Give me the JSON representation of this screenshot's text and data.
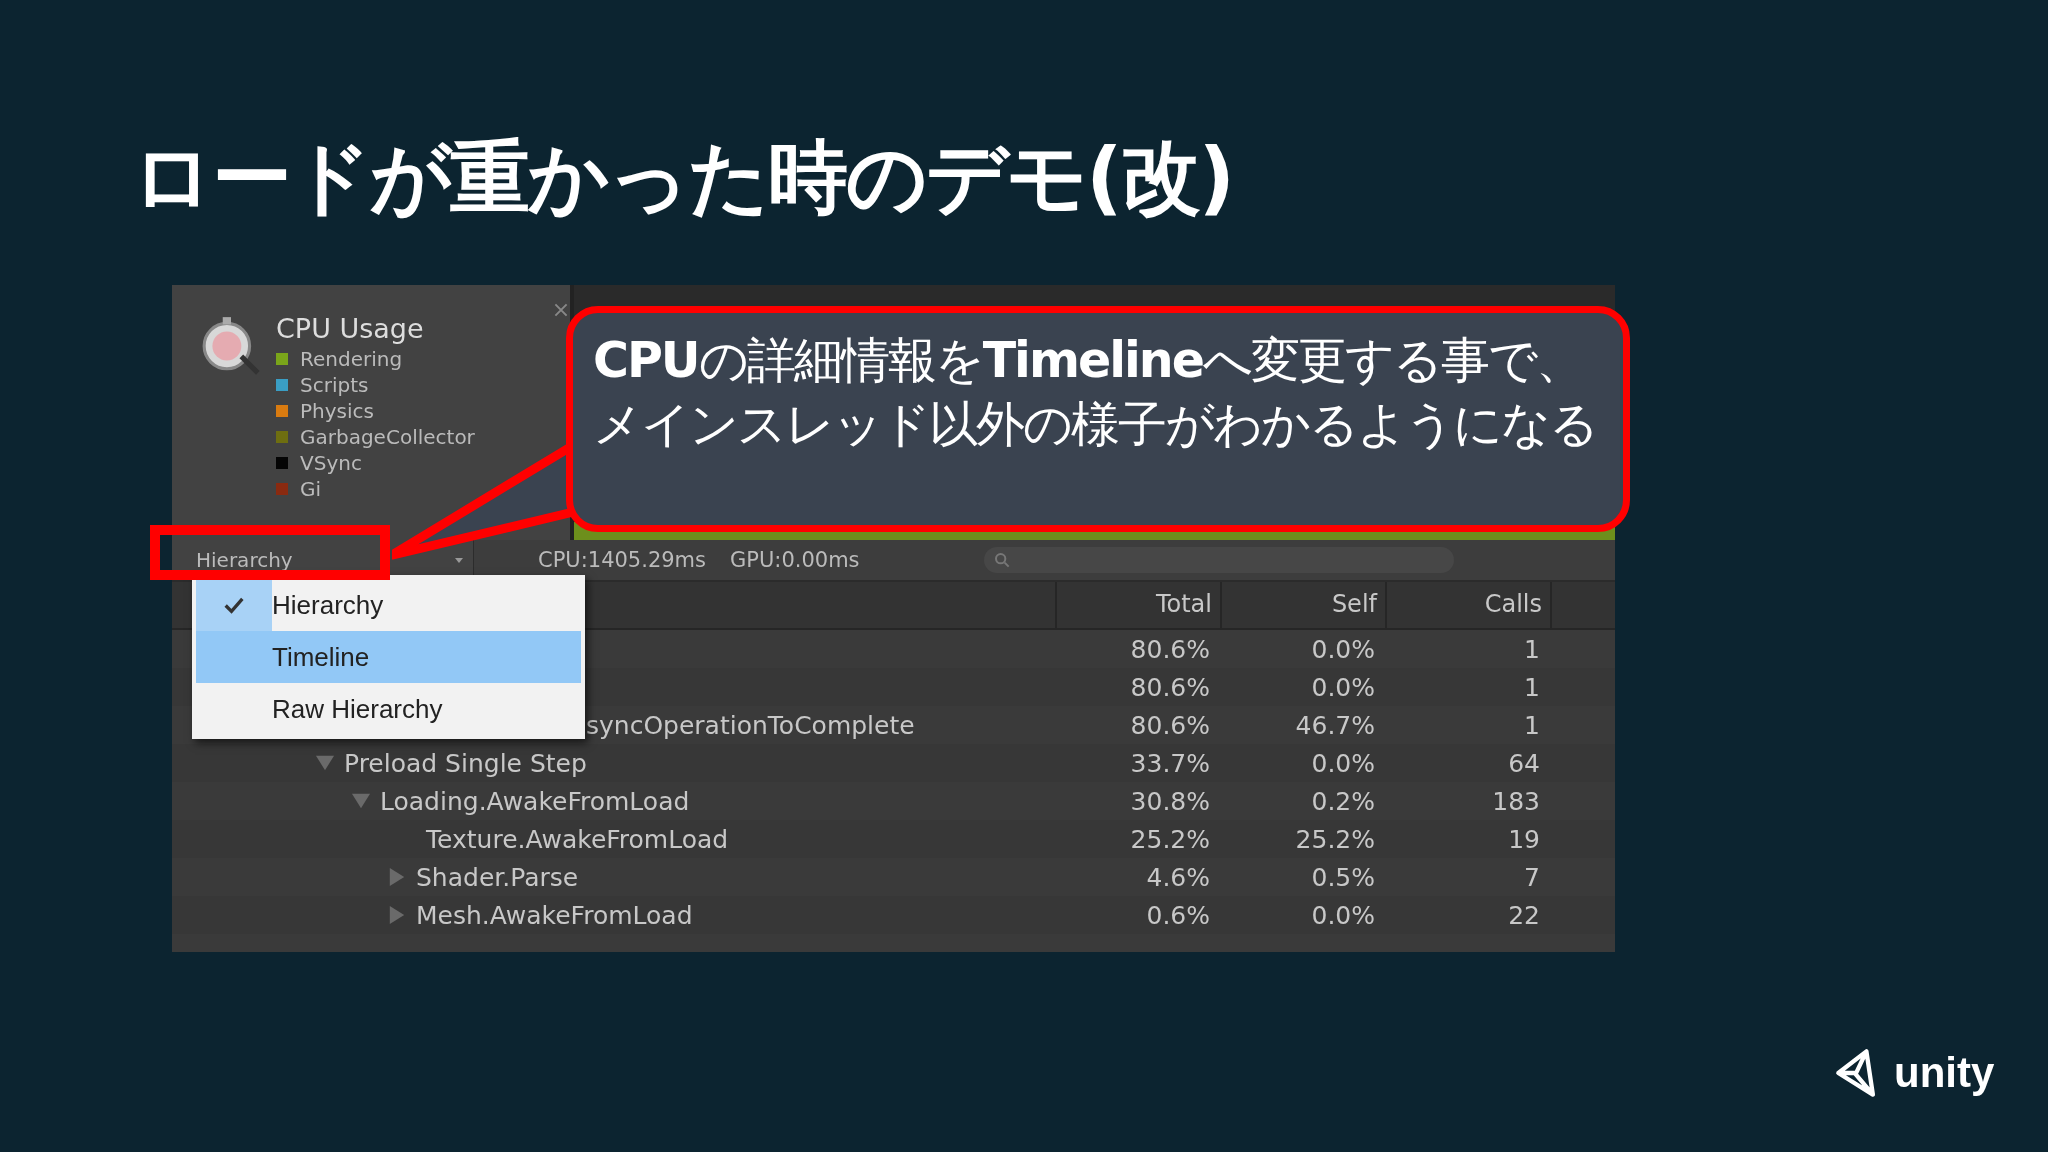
{
  "slide": {
    "title": "ロードが重かった時のデモ(改)"
  },
  "profiler": {
    "module": {
      "title": "CPU Usage",
      "legend": [
        {
          "label": "Rendering",
          "color": "#7aa51a"
        },
        {
          "label": "Scripts",
          "color": "#3a9ec4"
        },
        {
          "label": "Physics",
          "color": "#d97b10"
        },
        {
          "label": "GarbageCollector",
          "color": "#6e6e10"
        },
        {
          "label": "VSync",
          "color": "#050505"
        },
        {
          "label": "Gi",
          "color": "#8a2a10"
        }
      ]
    },
    "toolbar": {
      "view_dropdown": "Hierarchy",
      "cpu_time": "CPU:1405.29ms",
      "gpu_time": "GPU:0.00ms"
    },
    "view_menu": [
      {
        "label": "Hierarchy",
        "checked": true,
        "selected": false
      },
      {
        "label": "Timeline",
        "checked": false,
        "selected": true
      },
      {
        "label": "Raw Hierarchy",
        "checked": false,
        "selected": false
      }
    ],
    "table": {
      "columns": [
        "Total",
        "Self",
        "Calls"
      ],
      "rows": [
        {
          "total": "80.6%",
          "self": "0.0%",
          "calls": "1"
        },
        {
          "total": "80.6%",
          "self": "0.0%",
          "calls": "1"
        },
        {
          "name": "syncOperationToComplete",
          "total": "80.6%",
          "self": "46.7%",
          "calls": "1",
          "children": [
            {
              "name": "Preload Single Step",
              "total": "33.7%",
              "self": "0.0%",
              "calls": "64",
              "expanded": true,
              "children": [
                {
                  "name": "Loading.AwakeFromLoad",
                  "total": "30.8%",
                  "self": "0.2%",
                  "calls": "183",
                  "expanded": true,
                  "children": [
                    {
                      "name": "Texture.AwakeFromLoad",
                      "total": "25.2%",
                      "self": "25.2%",
                      "calls": "19"
                    },
                    {
                      "name": "Shader.Parse",
                      "total": "4.6%",
                      "self": "0.5%",
                      "calls": "7",
                      "expanded": false
                    },
                    {
                      "name": "Mesh.AwakeFromLoad",
                      "total": "0.6%",
                      "self": "0.0%",
                      "calls": "22",
                      "expanded": false
                    }
                  ]
                }
              ]
            }
          ]
        }
      ]
    }
  },
  "callout": {
    "text": "**CPU**の詳細情報を**Timeline**へ変更する事で、メインスレッド以外の様子がわかるようになる"
  },
  "logo": {
    "text": "unity"
  }
}
